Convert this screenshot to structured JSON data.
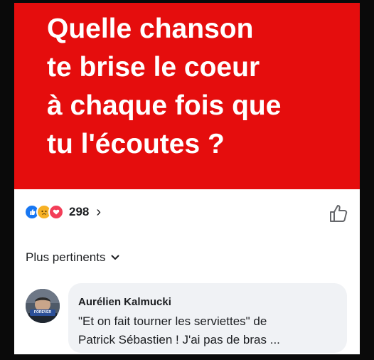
{
  "post": {
    "banner_color": "#e50d0d",
    "lines": [
      "Quelle chanson",
      "te brise le coeur",
      "à chaque fois que",
      "tu l'écoutes ?"
    ]
  },
  "reactions": {
    "icons": [
      "like-icon",
      "sad-icon",
      "love-icon"
    ],
    "count": "298",
    "chevron": "›"
  },
  "like_button": {
    "icon": "thumbs-up-icon"
  },
  "sort": {
    "label": "Plus pertinents"
  },
  "comment": {
    "author": "Aurélien Kalmucki",
    "avatar_badge": "FOREVER",
    "lines": [
      "\"Et on fait tourner les serviettes\" de",
      "Patrick Sébastien ! J'ai pas de bras ..."
    ]
  }
}
